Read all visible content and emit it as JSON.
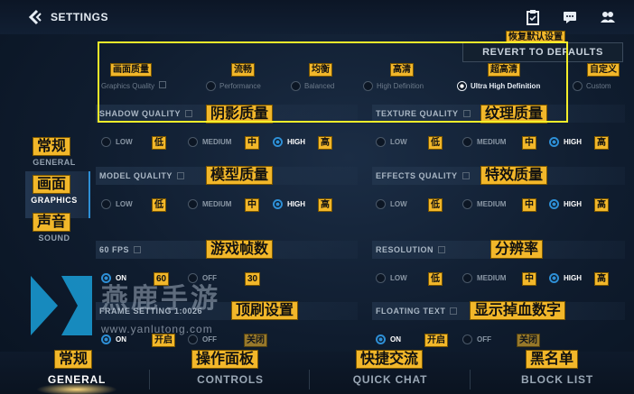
{
  "header": {
    "title": "SETTINGS",
    "reset_tag": "恢复默认设置",
    "revert_label": "REVERT TO DEFAULTS"
  },
  "graphics_quality": {
    "label": "Graphics Quality",
    "label_zh": "画面质量",
    "options": [
      {
        "label": "Performance",
        "zh": "流畅",
        "selected": false
      },
      {
        "label": "Balanced",
        "zh": "均衡",
        "selected": false
      },
      {
        "label": "High Definition",
        "zh": "高清",
        "selected": false
      },
      {
        "label": "Ultra High Definition",
        "zh": "超高清",
        "selected": true
      },
      {
        "label": "Custom",
        "zh": "自定义",
        "selected": false
      }
    ]
  },
  "sidebar": {
    "items": [
      {
        "zh": "常规",
        "label": "GENERAL"
      },
      {
        "zh": "画面",
        "label": "GRAPHICS"
      },
      {
        "zh": "声音",
        "label": "SOUND"
      }
    ],
    "active": "GRAPHICS"
  },
  "options_common": {
    "low": "LOW",
    "medium": "MEDIUM",
    "high": "HIGH",
    "low_zh": "低",
    "medium_zh": "中",
    "high_zh": "高",
    "on": "ON",
    "off": "OFF",
    "on_zh": "开启",
    "off_zh": "关闭"
  },
  "settings": {
    "shadow_quality": {
      "label": "SHADOW QUALITY",
      "zh": "阴影质量",
      "selected": "HIGH"
    },
    "texture_quality": {
      "label": "TEXTURE QUALITY",
      "zh": "纹理质量",
      "selected": "HIGH"
    },
    "model_quality": {
      "label": "MODEL QUALITY",
      "zh": "模型质量",
      "selected": "HIGH"
    },
    "effects_quality": {
      "label": "EFFECTS QUALITY",
      "zh": "特效质量",
      "selected": "HIGH"
    },
    "fps": {
      "label": "60 FPS",
      "zh": "游戏帧数",
      "on_zh": "60",
      "off_zh": "30",
      "selected": "ON"
    },
    "resolution": {
      "label": "RESOLUTION",
      "zh": "分辨率",
      "selected": "HIGH"
    },
    "frame_setting": {
      "label": "FRAME SETTING  1:0026",
      "zh": "顶刷设置",
      "selected": "ON"
    },
    "floating_text": {
      "label": "FLOATING TEXT",
      "zh": "显示掉血数字",
      "selected": "ON"
    }
  },
  "watermark": {
    "text": "燕鹿手游",
    "url": "www.yanlutong.com"
  },
  "bottom_tabs": [
    {
      "zh": "常规",
      "label": "GENERAL"
    },
    {
      "zh": "操作面板",
      "label": "CONTROLS"
    },
    {
      "zh": "快捷交流",
      "label": "QUICK CHAT"
    },
    {
      "zh": "黑名单",
      "label": "BLOCK LIST"
    }
  ],
  "colors": {
    "accent": "#2e8fd6",
    "tag": "#f2b72a",
    "highlight": "#f4ee2a",
    "watermark_blue": "#1a9fd8"
  },
  "icons": {
    "back": "back-chevron-icon",
    "clipboard": "clipboard-icon",
    "chat": "chat-icon",
    "friends": "friends-icon",
    "info": "info-icon"
  }
}
